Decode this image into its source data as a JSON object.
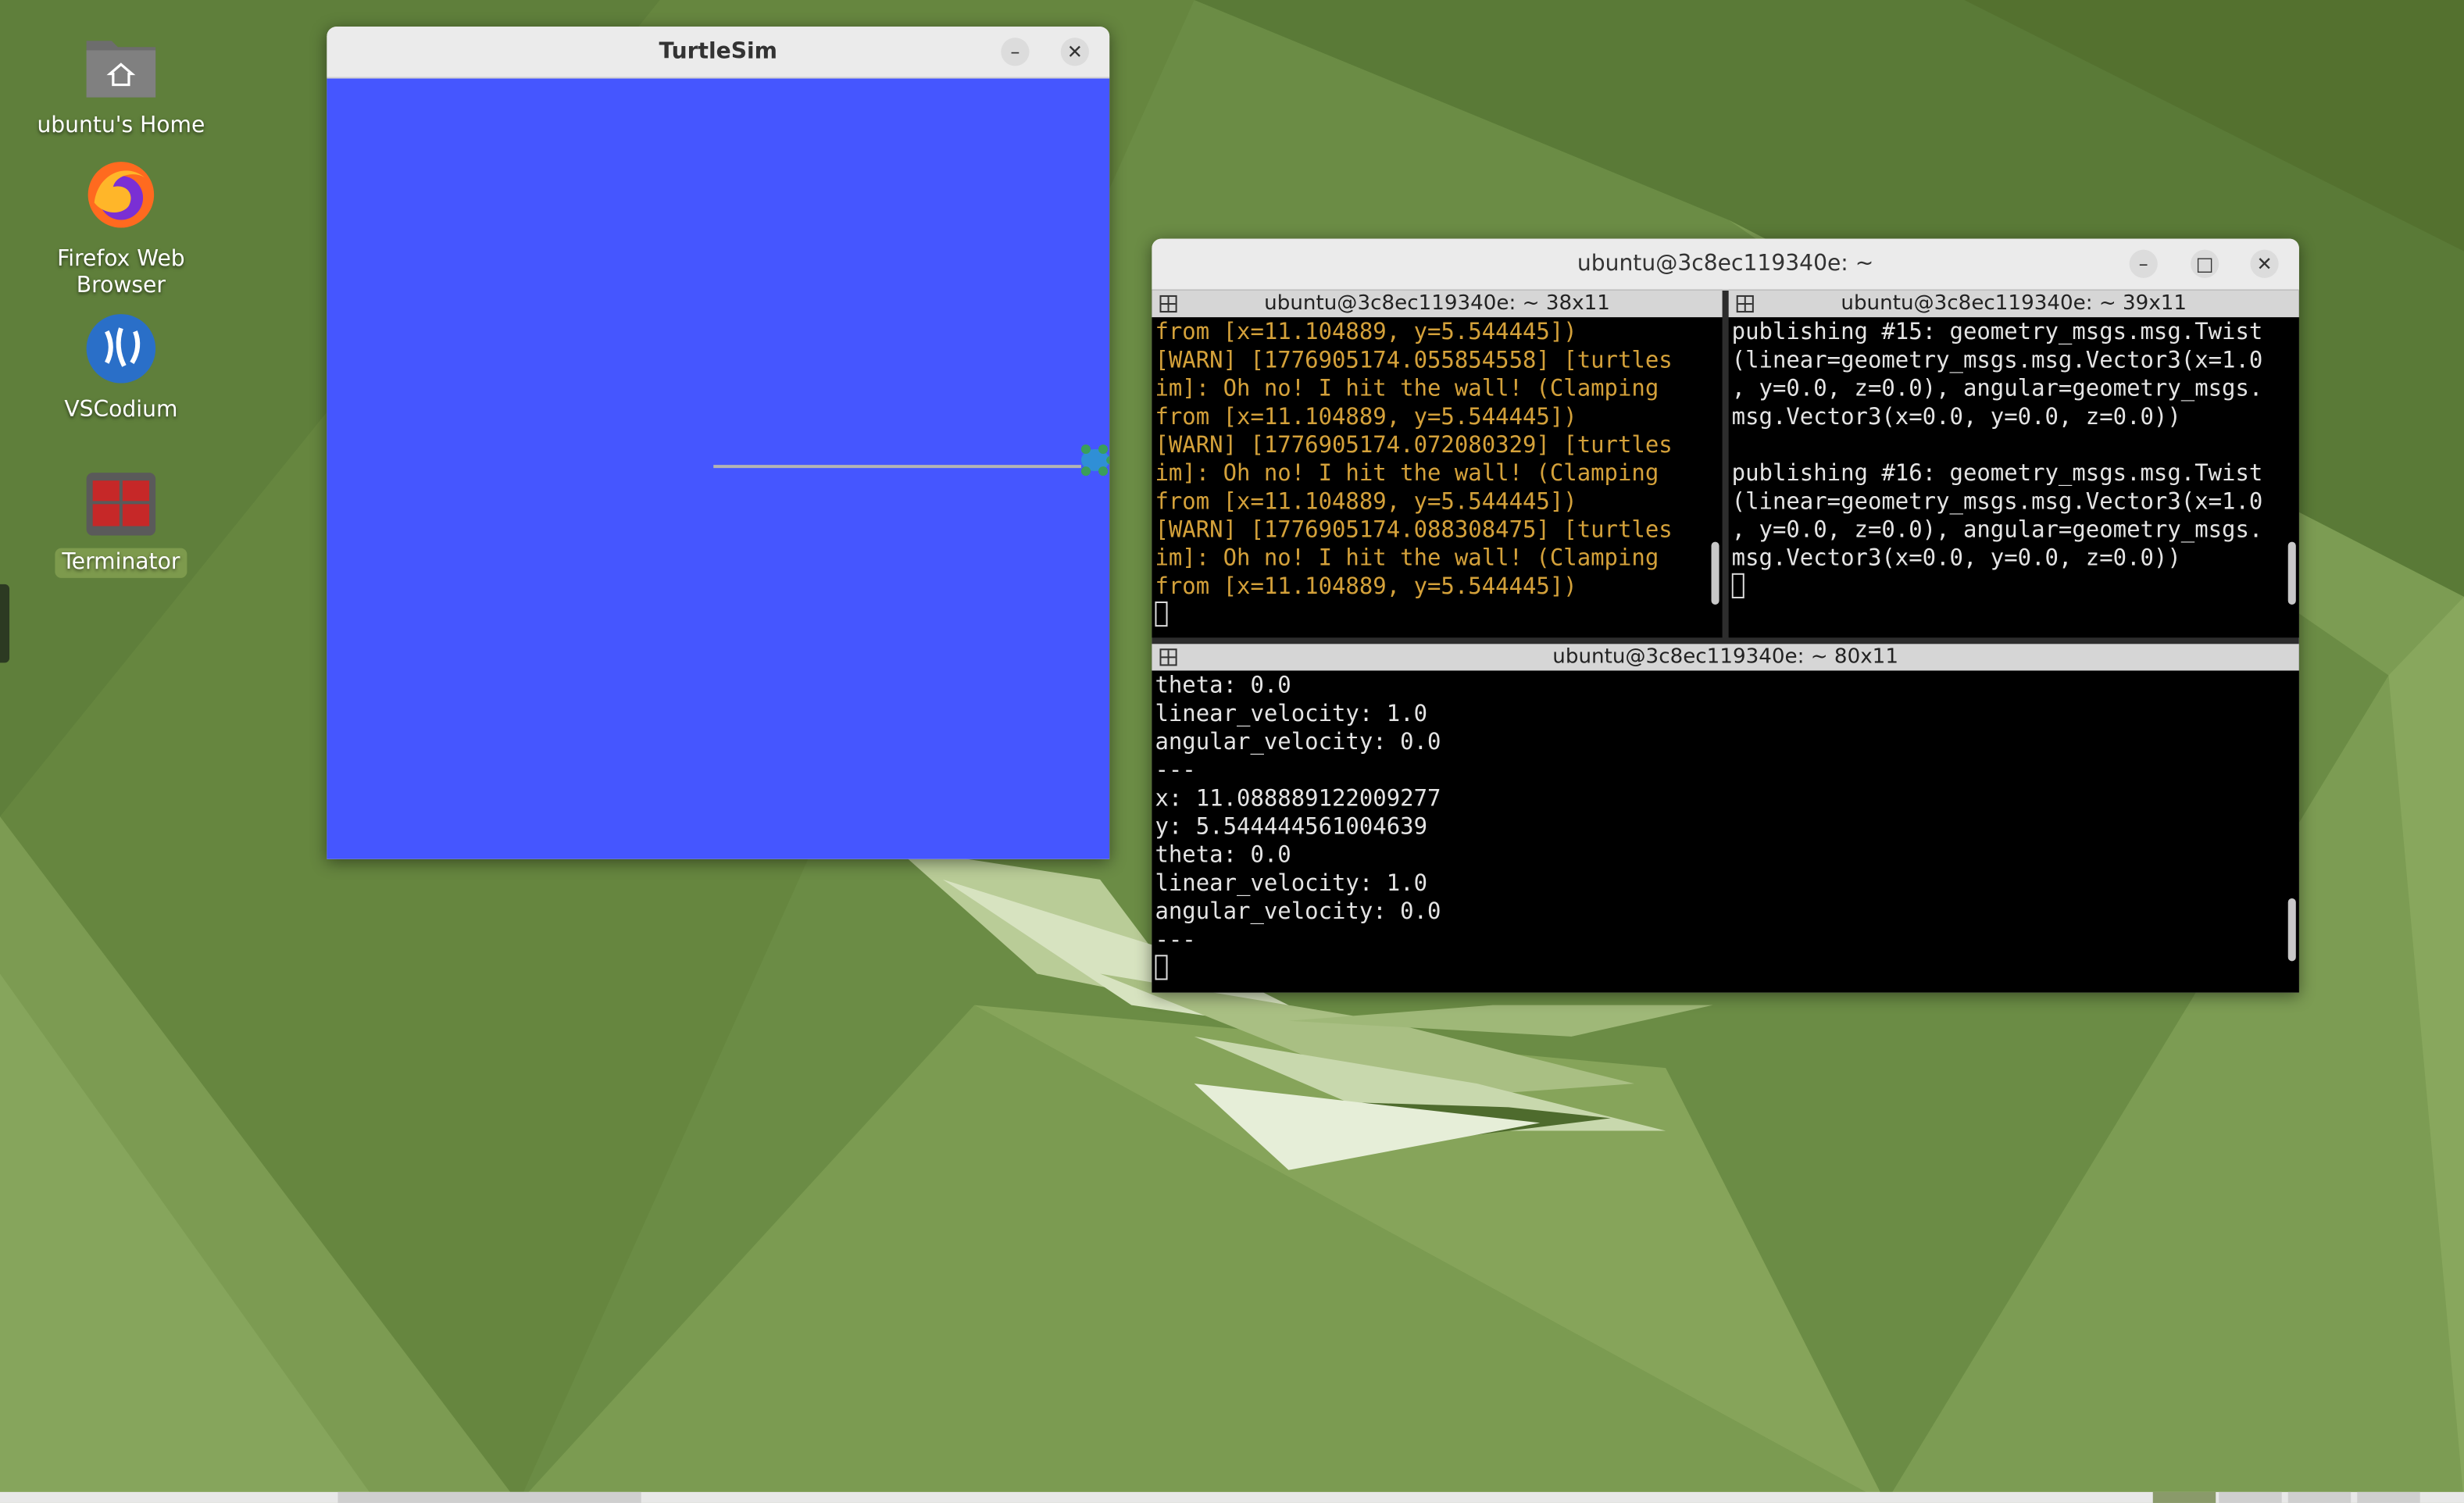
{
  "desktop": {
    "icons": [
      {
        "label": "ubuntu's Home",
        "icon": "home-folder-icon"
      },
      {
        "label": "Firefox Web Browser",
        "icon": "firefox-icon"
      },
      {
        "label": "VSCodium",
        "icon": "vscodium-icon"
      },
      {
        "label": "Terminator",
        "icon": "terminator-icon"
      }
    ]
  },
  "turtlesim": {
    "title": "TurtleSim",
    "background_color": "#4556ff",
    "minimize": "–",
    "close": "✕"
  },
  "terminator": {
    "title": "ubuntu@3c8ec119340e: ~",
    "minimize": "–",
    "maximize": "□",
    "close": "✕",
    "panes": [
      {
        "header": "ubuntu@3c8ec119340e: ~ 38x11",
        "lines": [
          "from [x=11.104889, y=5.544445])",
          "[WARN] [1776905174.055854558] [turtles",
          "im]: Oh no! I hit the wall! (Clamping",
          "from [x=11.104889, y=5.544445])",
          "[WARN] [1776905174.072080329] [turtles",
          "im]: Oh no! I hit the wall! (Clamping",
          "from [x=11.104889, y=5.544445])",
          "[WARN] [1776905174.088308475] [turtles",
          "im]: Oh no! I hit the wall! (Clamping",
          "from [x=11.104889, y=5.544445])"
        ]
      },
      {
        "header": "ubuntu@3c8ec119340e: ~ 39x11",
        "lines": [
          "publishing #15: geometry_msgs.msg.Twist",
          "(linear=geometry_msgs.msg.Vector3(x=1.0",
          ", y=0.0, z=0.0), angular=geometry_msgs.",
          "msg.Vector3(x=0.0, y=0.0, z=0.0))",
          "",
          "publishing #16: geometry_msgs.msg.Twist",
          "(linear=geometry_msgs.msg.Vector3(x=1.0",
          ", y=0.0, z=0.0), angular=geometry_msgs.",
          "msg.Vector3(x=0.0, y=0.0, z=0.0))"
        ]
      },
      {
        "header": "ubuntu@3c8ec119340e: ~ 80x11",
        "lines": [
          "theta: 0.0",
          "linear_velocity: 1.0",
          "angular_velocity: 0.0",
          "---",
          "x: 11.088889122009277",
          "y: 5.544444561004639",
          "theta: 0.0",
          "linear_velocity: 1.0",
          "angular_velocity: 0.0",
          "---"
        ]
      }
    ]
  }
}
